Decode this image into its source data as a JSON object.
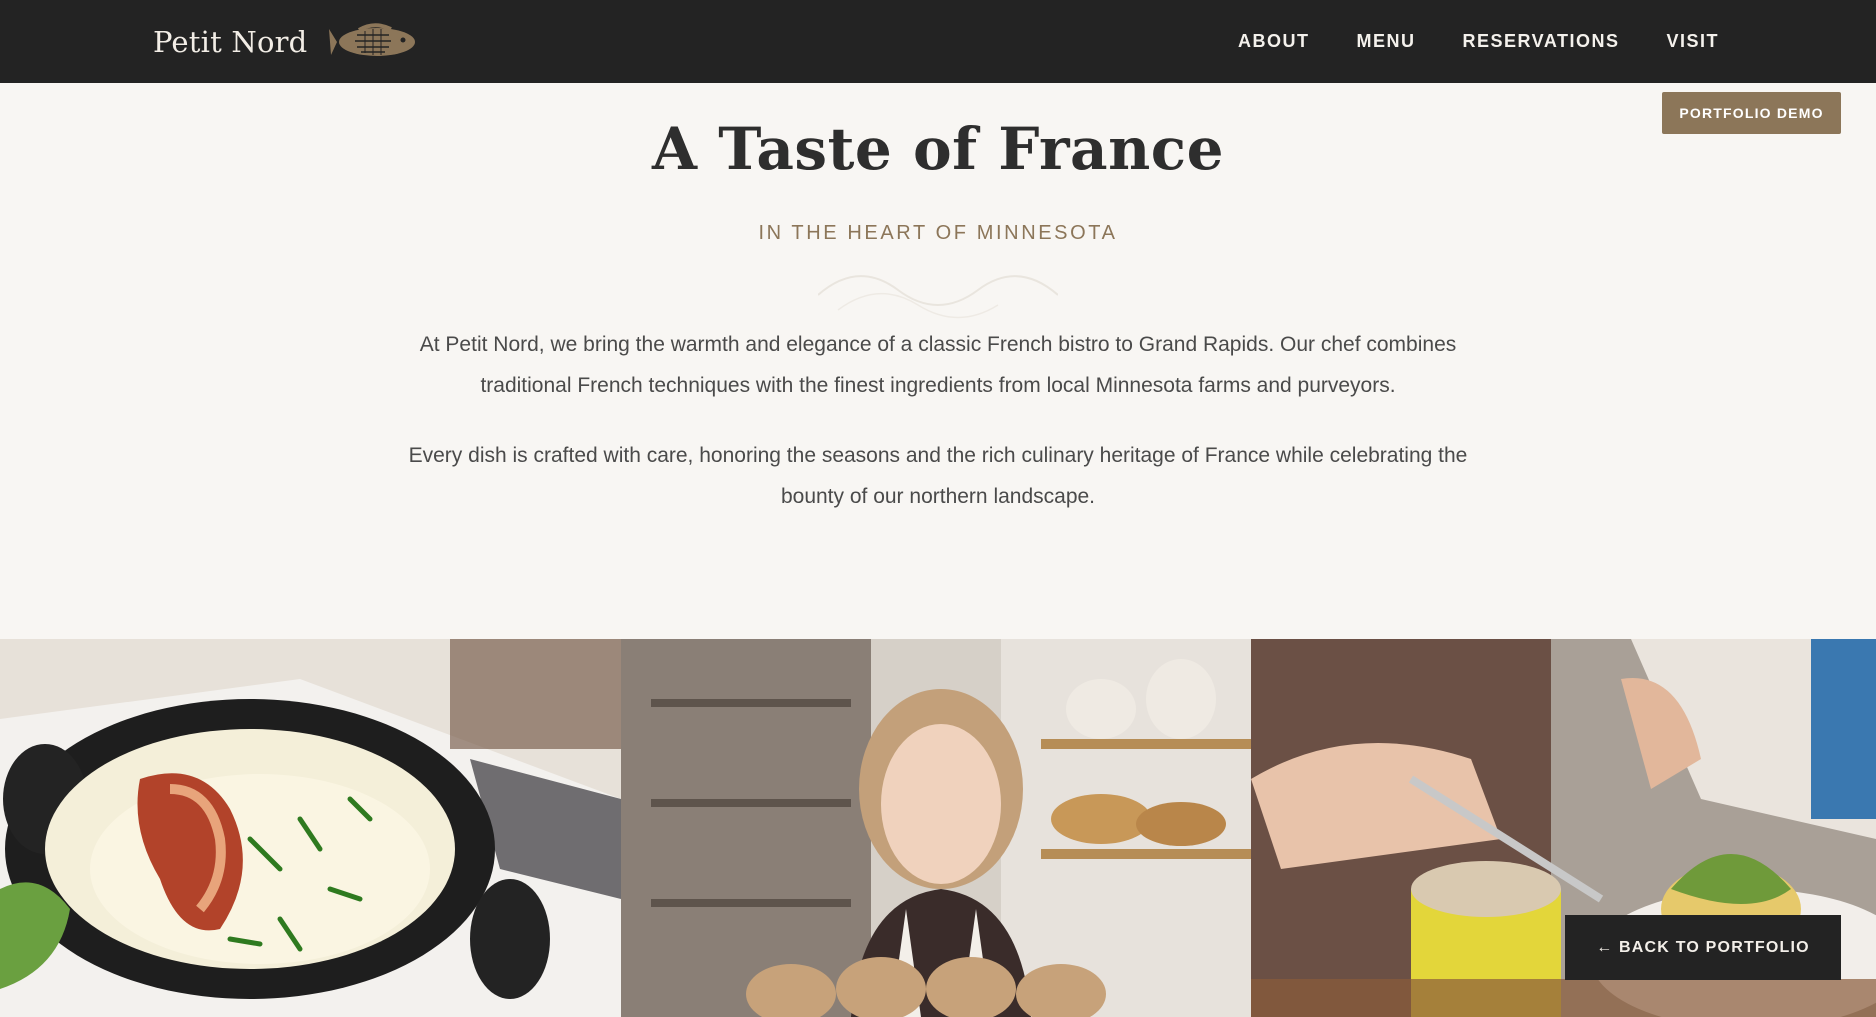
{
  "nav": {
    "brand": "Petit Nord",
    "brand_icon": "fish-icon",
    "links": [
      "ABOUT",
      "MENU",
      "RESERVATIONS",
      "VISIT"
    ]
  },
  "badge": "PORTFOLIO DEMO",
  "hero": {
    "title": "A Taste of France",
    "subtitle": "IN THE HEART OF MINNESOTA",
    "paragraphs": [
      "At Petit Nord, we bring the warmth and elegance of a classic French bistro to Grand Rapids. Our chef combines traditional French techniques with the finest ingredients from local Minnesota farms and purveyors.",
      "Every dish is crafted with care, honoring the seasons and the rich culinary heritage of France while celebrating the bounty of our northern landscape."
    ]
  },
  "gallery": {
    "photos": [
      "gratin-dish-photo",
      "baker-portrait-photo",
      "brunch-table-photo"
    ]
  },
  "back_button": "← BACK TO PORTFOLIO",
  "colors": {
    "nav_bg": "#232323",
    "page_bg": "#f8f6f3",
    "accent": "#8c7659"
  }
}
